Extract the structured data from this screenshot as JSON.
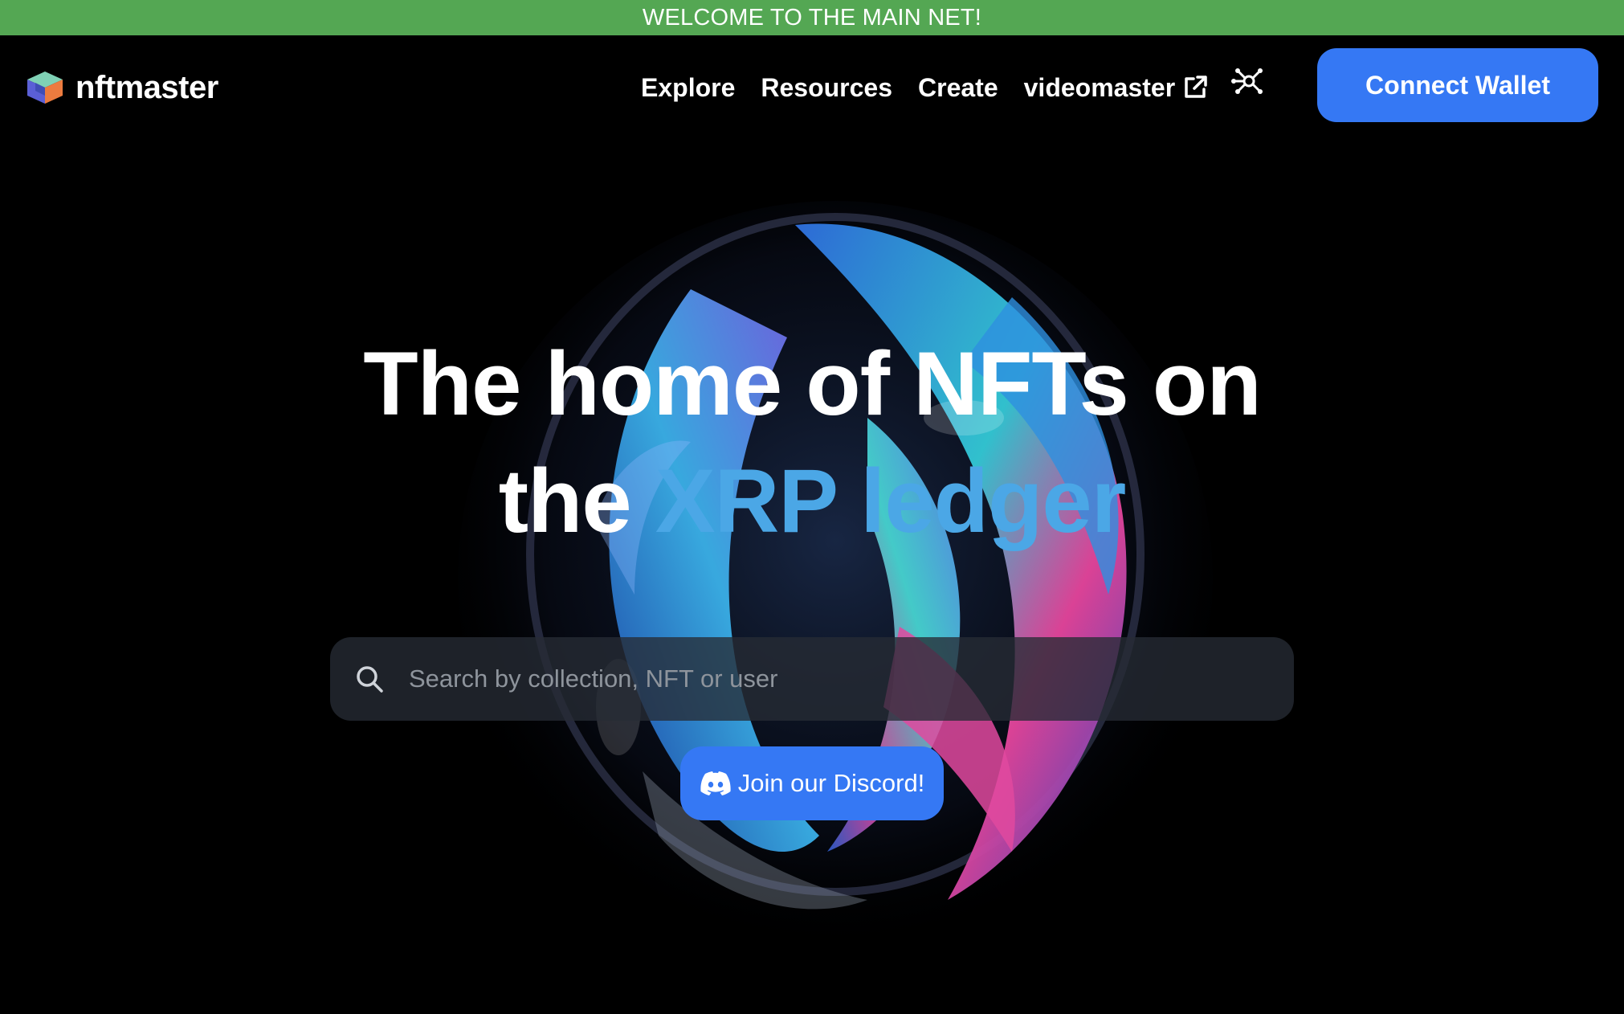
{
  "banner": {
    "text": "WELCOME TO THE MAIN NET!"
  },
  "brand": {
    "name": "nftmaster",
    "icon": "cube-logo-icon"
  },
  "nav": {
    "links": [
      {
        "label": "Explore"
      },
      {
        "label": "Resources"
      },
      {
        "label": "Create"
      },
      {
        "label": "videomaster",
        "icon": "external-link-icon"
      }
    ],
    "network_icon": "network-hub-icon",
    "connect_label": "Connect Wallet"
  },
  "hero": {
    "line1": "The home of NFTs on",
    "line2_plain": "the",
    "line2_accent": "XRP ledger"
  },
  "search": {
    "placeholder": "Search by collection, NFT or user",
    "value": "",
    "icon": "search-icon"
  },
  "discord": {
    "label": "Join our Discord!",
    "icon": "discord-icon"
  },
  "colors": {
    "banner": "#54a753",
    "accent": "#4ba7e6",
    "button": "#3578f4",
    "background": "#000000"
  }
}
